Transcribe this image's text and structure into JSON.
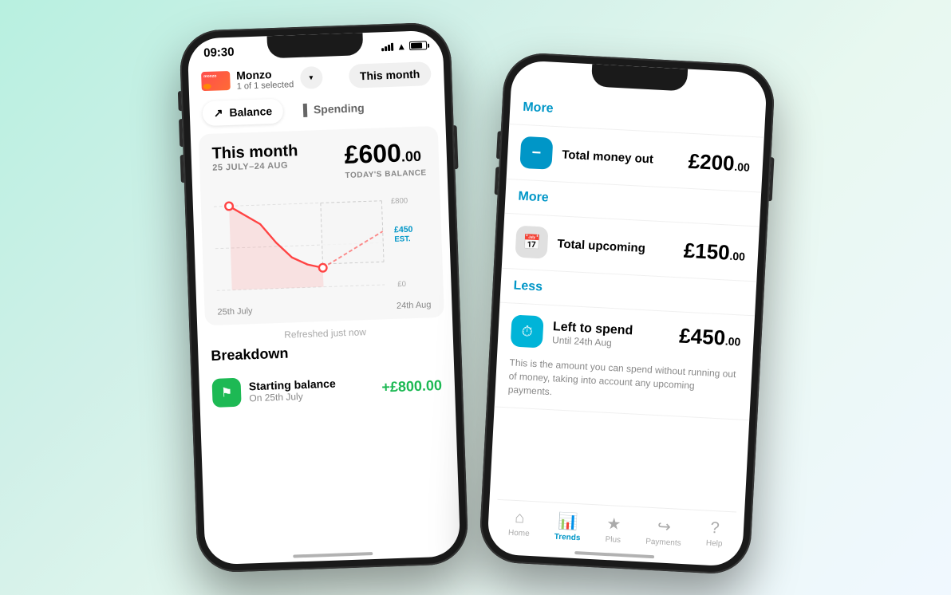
{
  "left_phone": {
    "status": {
      "time": "09:30"
    },
    "header": {
      "account_name": "Monzo",
      "account_sub": "1 of 1 selected",
      "this_month_btn": "This month"
    },
    "tabs": [
      {
        "label": "Balance",
        "active": true
      },
      {
        "label": "Spending",
        "active": false
      }
    ],
    "balance_section": {
      "title": "This month",
      "date_range": "25 JULY–24 AUG",
      "today_label": "TODAY'S BALANCE",
      "amount_main": "£600",
      "amount_cents": ".00",
      "chart": {
        "y_labels": [
          "£800",
          "",
          "£0"
        ],
        "x_labels": [
          "25th July",
          "24th Aug"
        ],
        "est_amount": "£450",
        "est_label": "EST."
      }
    },
    "refreshed": "Refreshed just now",
    "breakdown": {
      "title": "Breakdown",
      "items": [
        {
          "name": "Starting balance",
          "sub": "On 25th July",
          "amount": "+£800.00",
          "color": "green"
        }
      ]
    }
  },
  "right_phone": {
    "more_links": [
      {
        "label": "More"
      },
      {
        "label": "More"
      },
      {
        "label": "Less"
      }
    ],
    "summary_items": [
      {
        "label": "Total money out",
        "amount_big": "£200",
        "amount_small": ".00",
        "icon_type": "blue",
        "icon": "–"
      },
      {
        "label": "Total upcoming",
        "amount_big": "£150",
        "amount_small": ".00",
        "icon_type": "gray",
        "icon": "📅"
      }
    ],
    "left_to_spend": {
      "label": "Left to spend",
      "sub": "Until 24th Aug",
      "amount_big": "£450",
      "amount_small": ".00",
      "description": "This is the amount you can spend without running out of money, taking into account any upcoming payments."
    },
    "nav": [
      {
        "label": "Home",
        "icon": "⌂",
        "active": false
      },
      {
        "label": "Trends",
        "icon": "📊",
        "active": true
      },
      {
        "label": "Plus",
        "icon": "★",
        "active": false
      },
      {
        "label": "Payments",
        "icon": "↪",
        "active": false
      },
      {
        "label": "Help",
        "icon": "?",
        "active": false
      }
    ]
  }
}
